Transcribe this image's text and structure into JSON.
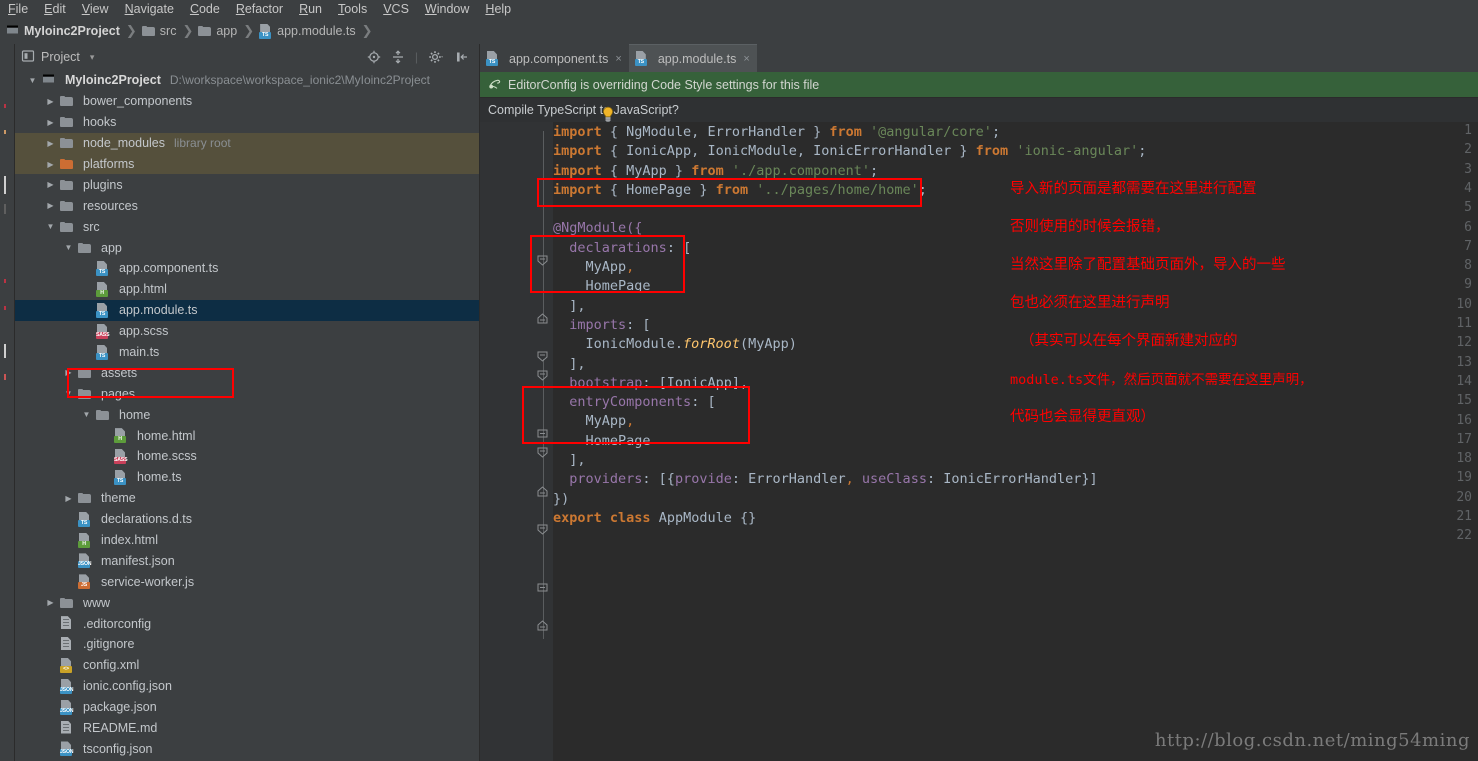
{
  "menu": {
    "items": [
      "File",
      "Edit",
      "View",
      "Navigate",
      "Code",
      "Refactor",
      "Run",
      "Tools",
      "VCS",
      "Window",
      "Help"
    ]
  },
  "breadcrumb": {
    "items": [
      {
        "label": "MyIoinc2Project",
        "icon": "module-icon"
      },
      {
        "label": "src",
        "icon": "folder-icon"
      },
      {
        "label": "app",
        "icon": "folder-icon"
      },
      {
        "label": "app.module.ts",
        "icon": "ts-file-icon"
      }
    ]
  },
  "project_panel": {
    "title": "Project",
    "caret": "▾",
    "toolbar_icons": [
      "locate-icon",
      "collapse-all-icon",
      "settings-gear-icon",
      "hide-panel-icon"
    ]
  },
  "tree": [
    {
      "depth": 0,
      "arrow": "▼",
      "label": "MyIoinc2Project",
      "bold": true,
      "icon": "module-icon",
      "sub": "D:\\workspace\\workspace_ionic2\\MyIoinc2Project"
    },
    {
      "depth": 1,
      "arrow": "▶",
      "label": "bower_components",
      "icon": "folder-icon"
    },
    {
      "depth": 1,
      "arrow": "▶",
      "label": "hooks",
      "icon": "folder-icon"
    },
    {
      "depth": 1,
      "arrow": "▶",
      "label": "node_modules",
      "icon": "folder-icon",
      "sub": "library root",
      "excluded": true
    },
    {
      "depth": 1,
      "arrow": "▶",
      "label": "platforms",
      "icon": "folder-orange-icon",
      "excluded": true
    },
    {
      "depth": 1,
      "arrow": "▶",
      "label": "plugins",
      "icon": "folder-icon"
    },
    {
      "depth": 1,
      "arrow": "▶",
      "label": "resources",
      "icon": "folder-icon"
    },
    {
      "depth": 1,
      "arrow": "▼",
      "label": "src",
      "icon": "folder-icon"
    },
    {
      "depth": 2,
      "arrow": "▼",
      "label": "app",
      "icon": "folder-icon"
    },
    {
      "depth": 3,
      "arrow": "",
      "label": "app.component.ts",
      "icon": "ts-file-icon"
    },
    {
      "depth": 3,
      "arrow": "",
      "label": "app.html",
      "icon": "html-file-icon"
    },
    {
      "depth": 3,
      "arrow": "",
      "label": "app.module.ts",
      "icon": "ts-file-icon",
      "selected": true
    },
    {
      "depth": 3,
      "arrow": "",
      "label": "app.scss",
      "icon": "scss-file-icon"
    },
    {
      "depth": 3,
      "arrow": "",
      "label": "main.ts",
      "icon": "ts-file-icon"
    },
    {
      "depth": 2,
      "arrow": "▶",
      "label": "assets",
      "icon": "folder-icon"
    },
    {
      "depth": 2,
      "arrow": "▼",
      "label": "pages",
      "icon": "folder-icon"
    },
    {
      "depth": 3,
      "arrow": "▼",
      "label": "home",
      "icon": "folder-icon"
    },
    {
      "depth": 4,
      "arrow": "",
      "label": "home.html",
      "icon": "html-file-icon"
    },
    {
      "depth": 4,
      "arrow": "",
      "label": "home.scss",
      "icon": "scss-file-icon"
    },
    {
      "depth": 4,
      "arrow": "",
      "label": "home.ts",
      "icon": "ts-file-icon"
    },
    {
      "depth": 2,
      "arrow": "▶",
      "label": "theme",
      "icon": "folder-icon"
    },
    {
      "depth": 2,
      "arrow": "",
      "label": "declarations.d.ts",
      "icon": "ts-file-icon"
    },
    {
      "depth": 2,
      "arrow": "",
      "label": "index.html",
      "icon": "html-file-icon"
    },
    {
      "depth": 2,
      "arrow": "",
      "label": "manifest.json",
      "icon": "json-file-icon"
    },
    {
      "depth": 2,
      "arrow": "",
      "label": "service-worker.js",
      "icon": "js-file-icon"
    },
    {
      "depth": 1,
      "arrow": "▶",
      "label": "www",
      "icon": "folder-icon"
    },
    {
      "depth": 1,
      "arrow": "",
      "label": ".editorconfig",
      "icon": "text-file-icon"
    },
    {
      "depth": 1,
      "arrow": "",
      "label": ".gitignore",
      "icon": "text-file-icon"
    },
    {
      "depth": 1,
      "arrow": "",
      "label": "config.xml",
      "icon": "xml-file-icon"
    },
    {
      "depth": 1,
      "arrow": "",
      "label": "ionic.config.json",
      "icon": "json-file-icon"
    },
    {
      "depth": 1,
      "arrow": "",
      "label": "package.json",
      "icon": "json-file-icon"
    },
    {
      "depth": 1,
      "arrow": "",
      "label": "README.md",
      "icon": "text-file-icon"
    },
    {
      "depth": 1,
      "arrow": "",
      "label": "tsconfig.json",
      "icon": "json-file-icon"
    }
  ],
  "editor": {
    "tabs": [
      {
        "label": "app.component.ts",
        "icon": "ts-file-icon",
        "active": false,
        "close": "×"
      },
      {
        "label": "app.module.ts",
        "icon": "ts-file-icon",
        "active": true,
        "close": "×"
      }
    ],
    "notification_green": {
      "text": "EditorConfig is overriding Code Style settings for this file",
      "icon": "editorconfig-icon",
      "color": "#36613a"
    },
    "notification_prompt": {
      "text": "Compile TypeScript to JavaScript?",
      "icon": "lightbulb-icon"
    },
    "line_numbers": [
      "1",
      "2",
      "3",
      "4",
      "5",
      "6",
      "7",
      "8",
      "9",
      "10",
      "11",
      "12",
      "13",
      "14",
      "15",
      "16",
      "17",
      "18",
      "19",
      "20",
      "21",
      "22"
    ],
    "lines": [
      {
        "n": 1,
        "tokens": [
          {
            "t": "import",
            "c": "kw"
          },
          {
            "t": " { NgModule, ErrorHandler } ",
            "c": "pl"
          },
          {
            "t": "from",
            "c": "kw"
          },
          {
            "t": " ",
            "c": "pl"
          },
          {
            "t": "'@angular/core'",
            "c": "str"
          },
          {
            "t": ";",
            "c": "pl"
          }
        ]
      },
      {
        "n": 2,
        "tokens": [
          {
            "t": "import",
            "c": "kw"
          },
          {
            "t": " { IonicApp, IonicModule, IonicErrorHandler } ",
            "c": "pl"
          },
          {
            "t": "from",
            "c": "kw"
          },
          {
            "t": " ",
            "c": "pl"
          },
          {
            "t": "'ionic-angular'",
            "c": "str"
          },
          {
            "t": ";",
            "c": "pl"
          }
        ]
      },
      {
        "n": 3,
        "tokens": [
          {
            "t": "import",
            "c": "kw"
          },
          {
            "t": " { MyApp } ",
            "c": "pl"
          },
          {
            "t": "from",
            "c": "kw"
          },
          {
            "t": " ",
            "c": "pl"
          },
          {
            "t": "'./app.component'",
            "c": "str"
          },
          {
            "t": ";",
            "c": "pl"
          }
        ]
      },
      {
        "n": 4,
        "tokens": [
          {
            "t": "import",
            "c": "kw"
          },
          {
            "t": " { HomePage } ",
            "c": "pl"
          },
          {
            "t": "from",
            "c": "kw"
          },
          {
            "t": " ",
            "c": "pl"
          },
          {
            "t": "'../pages/home/home'",
            "c": "str"
          },
          {
            "t": ";",
            "c": "pl"
          }
        ]
      },
      {
        "n": 5,
        "tokens": []
      },
      {
        "n": 6,
        "tokens": [
          {
            "t": "@NgModule({",
            "c": "fld"
          }
        ]
      },
      {
        "n": 7,
        "tokens": [
          {
            "t": "  ",
            "c": "pl"
          },
          {
            "t": "declarations",
            "c": "fld"
          },
          {
            "t": ": [",
            "c": "pl"
          }
        ]
      },
      {
        "n": 8,
        "tokens": [
          {
            "t": "    MyApp",
            "c": "pl"
          },
          {
            "t": ",",
            "c": "kw2"
          }
        ]
      },
      {
        "n": 9,
        "tokens": [
          {
            "t": "    HomePage",
            "c": "pl"
          }
        ]
      },
      {
        "n": 10,
        "tokens": [
          {
            "t": "  ],",
            "c": "pl"
          }
        ]
      },
      {
        "n": 11,
        "tokens": [
          {
            "t": "  ",
            "c": "pl"
          },
          {
            "t": "imports",
            "c": "fld"
          },
          {
            "t": ": [",
            "c": "pl"
          }
        ]
      },
      {
        "n": 12,
        "tokens": [
          {
            "t": "    IonicModule.",
            "c": "pl"
          },
          {
            "t": "forRoot",
            "c": "itl"
          },
          {
            "t": "(MyApp)",
            "c": "pl"
          }
        ]
      },
      {
        "n": 13,
        "tokens": [
          {
            "t": "  ],",
            "c": "pl"
          }
        ]
      },
      {
        "n": 14,
        "tokens": [
          {
            "t": "  ",
            "c": "pl"
          },
          {
            "t": "bootstrap",
            "c": "fld"
          },
          {
            "t": ": [IonicApp],",
            "c": "pl"
          }
        ]
      },
      {
        "n": 15,
        "tokens": [
          {
            "t": "  ",
            "c": "pl"
          },
          {
            "t": "entryComponents",
            "c": "fld"
          },
          {
            "t": ": [",
            "c": "pl"
          }
        ]
      },
      {
        "n": 16,
        "tokens": [
          {
            "t": "    MyApp",
            "c": "pl"
          },
          {
            "t": ",",
            "c": "kw2"
          }
        ]
      },
      {
        "n": 17,
        "tokens": [
          {
            "t": "    HomePage",
            "c": "pl"
          }
        ]
      },
      {
        "n": 18,
        "tokens": [
          {
            "t": "  ],",
            "c": "pl"
          }
        ]
      },
      {
        "n": 19,
        "tokens": [
          {
            "t": "  ",
            "c": "pl"
          },
          {
            "t": "providers",
            "c": "fld"
          },
          {
            "t": ": [{",
            "c": "pl"
          },
          {
            "t": "provide",
            "c": "fld"
          },
          {
            "t": ": ErrorHandler",
            "c": "pl"
          },
          {
            "t": ",",
            "c": "kw2"
          },
          {
            "t": " ",
            "c": "pl"
          },
          {
            "t": "useClass",
            "c": "fld"
          },
          {
            "t": ": IonicErrorHandler}]",
            "c": "pl"
          }
        ]
      },
      {
        "n": 20,
        "tokens": [
          {
            "t": "})",
            "c": "pl"
          }
        ]
      },
      {
        "n": 21,
        "tokens": [
          {
            "t": "export",
            "c": "kw"
          },
          {
            "t": " ",
            "c": "pl"
          },
          {
            "t": "class",
            "c": "kw"
          },
          {
            "t": " AppModule {}",
            "c": "pl"
          }
        ]
      },
      {
        "n": 22,
        "tokens": []
      }
    ]
  },
  "annotations": {
    "color": "#ff0000",
    "lines": [
      "导入新的页面是都需要在这里进行配置",
      "否则使用的时候会报错，",
      "当然这里除了配置基础页面外，导入的一些",
      "包也必须在这里进行声明",
      "（其实可以在每个界面新建对应的",
      "module.ts文件，然后页面就不需要在这里声明，",
      "代码也会显得更直观）"
    ]
  },
  "watermark": "http://blog.csdn.net/ming54ming"
}
